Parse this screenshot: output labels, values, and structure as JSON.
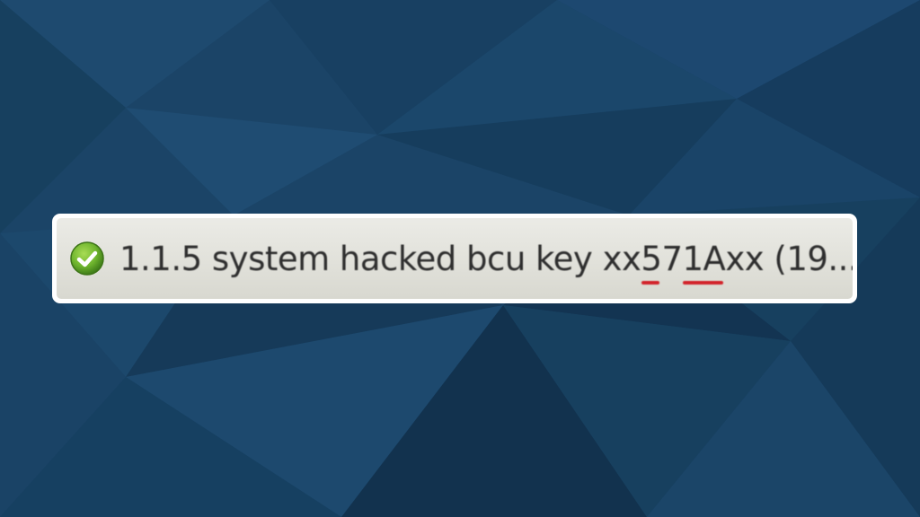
{
  "item": {
    "icon": "check-circle-icon",
    "status_color": "#6fb52e",
    "text_prefix": "1.1.5 system hacked bcu key xx",
    "mark_1": "5",
    "mark_mid": "7",
    "mark_2": "1A",
    "text_suffix": "xx (19..."
  }
}
